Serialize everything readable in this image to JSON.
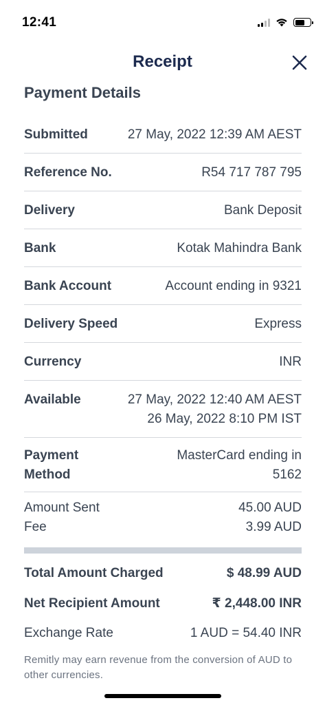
{
  "status_bar": {
    "time": "12:41"
  },
  "header": {
    "title": "Receipt"
  },
  "section_title": "Payment Details",
  "details": [
    {
      "label": "Submitted",
      "value": [
        "27 May, 2022 12:39 AM AEST"
      ]
    },
    {
      "label": "Reference No.",
      "value": [
        "R54 717 787 795"
      ]
    },
    {
      "label": "Delivery",
      "value": [
        "Bank Deposit"
      ]
    },
    {
      "label": "Bank",
      "value": [
        "Kotak Mahindra Bank"
      ]
    },
    {
      "label": "Bank Account",
      "value": [
        "Account ending in 9321"
      ]
    },
    {
      "label": "Delivery Speed",
      "value": [
        "Express"
      ]
    },
    {
      "label": "Currency",
      "value": [
        "INR"
      ]
    },
    {
      "label": "Available",
      "value": [
        "27 May, 2022 12:40 AM AEST",
        "26 May, 2022 8:10 PM IST"
      ]
    },
    {
      "label": [
        "Payment",
        "Method"
      ],
      "value": [
        "MasterCard ending in",
        "5162"
      ]
    }
  ],
  "amounts": {
    "amount_sent_label": "Amount Sent",
    "amount_sent_value": "45.00 AUD",
    "fee_label": "Fee",
    "fee_value": "3.99 AUD"
  },
  "totals": {
    "total_charged_label": "Total Amount Charged",
    "total_charged_value": "$ 48.99 AUD",
    "net_recipient_label": "Net Recipient Amount",
    "net_recipient_value": "₹ 2,448.00 INR",
    "exchange_rate_label": "Exchange Rate",
    "exchange_rate_value": "1 AUD = 54.40 INR"
  },
  "disclaimer": "Remitly may earn revenue from the conversion of AUD to other currencies.",
  "colors": {
    "title": "#1d2b4f",
    "text": "#3a4452",
    "divider": "#d4d7dc",
    "bar": "#cdd3db"
  }
}
